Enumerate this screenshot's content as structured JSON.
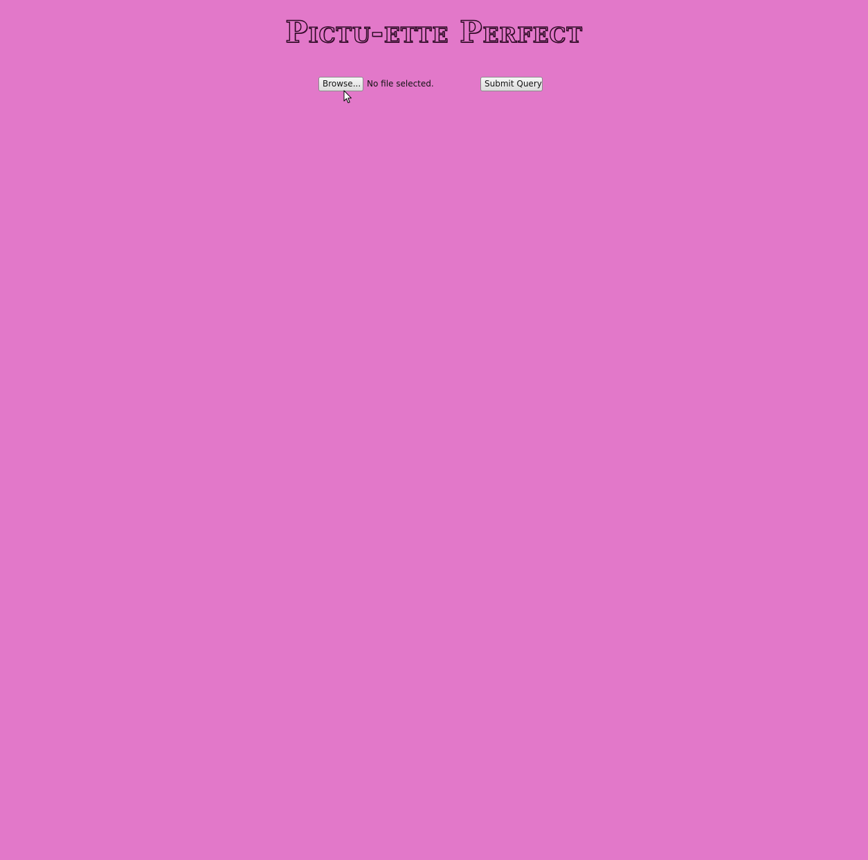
{
  "page": {
    "title": "Pictu-ette Perfect",
    "background_color": "#e278c9"
  },
  "upload_form": {
    "browse_label": "Browse...",
    "file_status": "No file selected.",
    "submit_label": "Submit Query"
  },
  "cursor": {
    "icon": "arrow-pointer-icon"
  }
}
